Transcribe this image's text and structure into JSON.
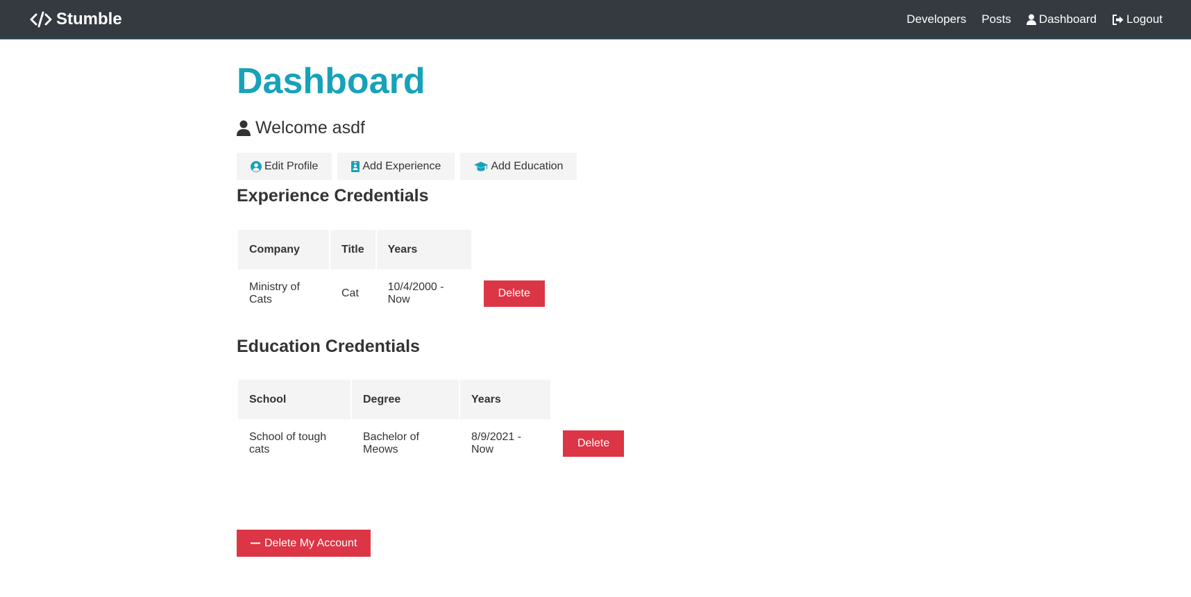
{
  "navbar": {
    "brand_icon": "code-icon",
    "brand": "Stumble",
    "links": [
      {
        "label": "Developers",
        "icon": ""
      },
      {
        "label": "Posts",
        "icon": ""
      },
      {
        "label": "Dashboard",
        "icon": "user-icon"
      },
      {
        "label": "Logout",
        "icon": "sign-out-icon"
      }
    ]
  },
  "page": {
    "title": "Dashboard",
    "welcome": "Welcome asdf"
  },
  "dashboard_buttons": [
    {
      "label": "Edit Profile",
      "icon": "user-circle-icon"
    },
    {
      "label": "Add Experience",
      "icon": "id-badge-icon"
    },
    {
      "label": "Add Education",
      "icon": "graduation-cap-icon"
    }
  ],
  "experience": {
    "title": "Experience Credentials",
    "headers": [
      "Company",
      "Title",
      "Years"
    ],
    "rows": [
      {
        "company": "Ministry of Cats",
        "title": "Cat",
        "years": "10/4/2000 - Now",
        "action": "Delete"
      }
    ]
  },
  "education": {
    "title": "Education Credentials",
    "headers": [
      "School",
      "Degree",
      "Years"
    ],
    "rows": [
      {
        "school": "School of tough cats",
        "degree": "Bachelor of Meows",
        "years": "8/9/2021 - Now",
        "action": "Delete"
      }
    ]
  },
  "delete_account": {
    "label": "Delete My Account",
    "icon": "minus-icon"
  },
  "colors": {
    "navbar_bg": "#343a40",
    "primary": "#17a2b8",
    "danger": "#dc3545",
    "light": "#f4f4f4",
    "text": "#333333"
  }
}
